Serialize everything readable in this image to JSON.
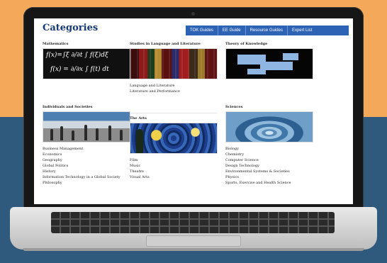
{
  "page": {
    "title": "Categories"
  },
  "nav": [
    "TOK Guides",
    "EE Guide",
    "Resource Guides",
    "Expert List"
  ],
  "columns": {
    "mathematics": {
      "heading": "Mathematics",
      "image": "math-equations-image"
    },
    "language": {
      "heading": "Studies in Language and Literature",
      "image": "books-image",
      "items": [
        "Language and Literature",
        "Literature and Performance"
      ]
    },
    "tok": {
      "heading": "Theory of Knowledge",
      "image": "puzzle-sky-image"
    },
    "individuals": {
      "heading": "Individuals and Societies",
      "image": "crowd-street-image",
      "items": [
        "Business Management",
        "Economics",
        "Geography",
        "Global Politics",
        "History",
        "Information Technology in a Global Society",
        "Philosophy"
      ]
    },
    "arts": {
      "heading": "The Arts",
      "image": "starry-night-image",
      "items": [
        "Film",
        "Music",
        "Theatre",
        "Visual Arts"
      ]
    },
    "sciences": {
      "heading": "Sciences",
      "image": "water-drop-image",
      "items": [
        "Biology",
        "Chemistry",
        "Computer Science",
        "Design Technology",
        "Environmental Systems & Societies",
        "Physics",
        "Sports, Exercise and Health Science"
      ]
    }
  },
  "colors": {
    "top_background": "#f3a85a",
    "bottom_background": "#2f5a7e",
    "nav_background": "#2d63b5",
    "title": "#173a78"
  }
}
